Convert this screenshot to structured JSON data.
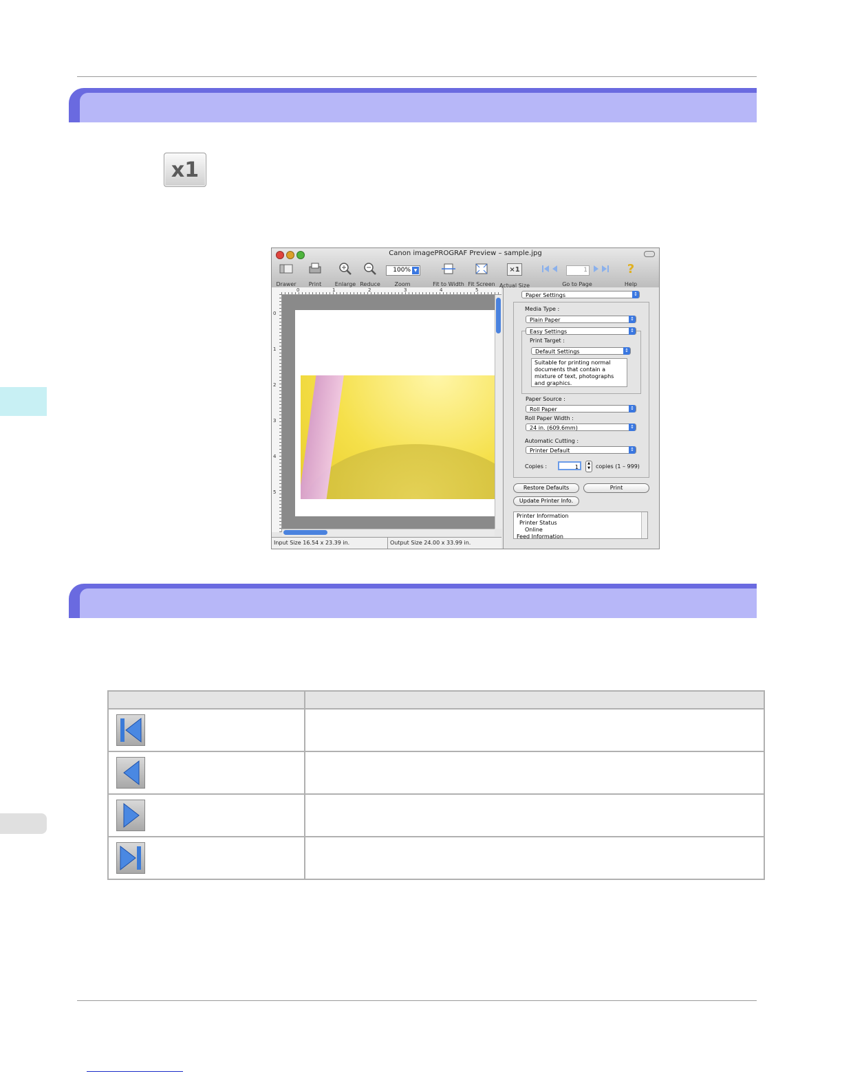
{
  "app_window": {
    "title": "Canon imagePROGRAF Preview – sample.jpg",
    "toolbar": [
      {
        "label": "Drawer",
        "icon": "drawer-icon"
      },
      {
        "label": "Print",
        "icon": "printer-icon"
      },
      {
        "label": "Enlarge",
        "icon": "zoom-in-icon"
      },
      {
        "label": "Reduce",
        "icon": "zoom-out-icon"
      },
      {
        "label": "Zoom",
        "icon": "zoom-select"
      },
      {
        "label": "Fit to Width",
        "icon": "fit-width-icon"
      },
      {
        "label": "Fit Screen",
        "icon": "fit-screen-icon"
      },
      {
        "label": "Actual Size",
        "icon": "actual-size-icon"
      },
      {
        "label": "Go to Page",
        "icon": "page-nav-icon"
      },
      {
        "label": "Help",
        "icon": "help-icon"
      }
    ],
    "zoom_value": "100%",
    "page_value": "1",
    "actual_size_glyph": "×1",
    "ruler_numbers": [
      "0",
      "1",
      "2",
      "3",
      "4",
      "5"
    ],
    "ruler_v_numbers": [
      "0",
      "1",
      "2",
      "3",
      "4",
      "5"
    ],
    "status_input": "Input Size 16.54 x 23.39 in.",
    "status_output": "Output Size 24.00 x 33.99 in.",
    "panel": {
      "top_select": "Paper Settings",
      "media_type_label": "Media Type :",
      "media_type": "Plain Paper",
      "easy_settings": "Easy Settings",
      "print_target_label": "Print Target :",
      "print_target": "Default Settings",
      "description": "Suitable for printing normal documents that contain a mixture of text, photographs and graphics.",
      "paper_source_label": "Paper Source :",
      "paper_source": "Roll Paper",
      "roll_width_label": "Roll Paper Width :",
      "roll_width": "24 in. (609.6mm)",
      "auto_cut_label": "Automatic Cutting :",
      "auto_cut": "Printer Default",
      "copies_label": "Copies :",
      "copies_value": "1",
      "copies_range": "copies (1 – 999)",
      "restore_button": "Restore Defaults",
      "print_button": "Print",
      "update_button": "Update Printer Info.",
      "info_lines": [
        "Printer Information",
        "  Printer Status",
        "    Online",
        "Feed Information"
      ]
    }
  },
  "large_button_glyph": "x1",
  "nav_table": {
    "rows": [
      {
        "icon": "first-page-icon"
      },
      {
        "icon": "previous-page-icon"
      },
      {
        "icon": "next-page-icon"
      },
      {
        "icon": "last-page-icon"
      }
    ]
  },
  "colors": {
    "banner_dark": "#6a6ae0",
    "banner_light": "#b7b7f8",
    "nav_blue": "#3a7ad8"
  }
}
